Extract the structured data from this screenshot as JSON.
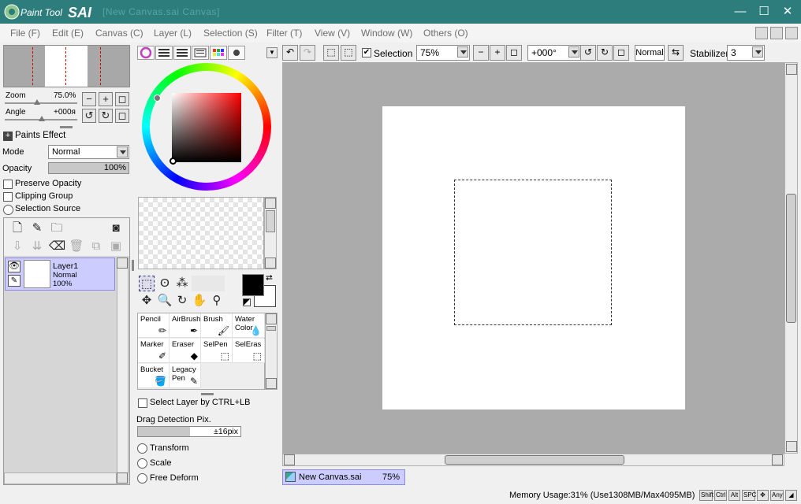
{
  "app": {
    "logo_text": "Paint Tool SAI",
    "title": "[New Canvas.sai  Canvas]"
  },
  "window_controls": {
    "minimize": "—",
    "maximize": "☐",
    "close": "✕"
  },
  "menu": {
    "items": [
      "File (F)",
      "Edit (E)",
      "Canvas (C)",
      "Layer (L)",
      "Selection (S)",
      "Filter (T)",
      "View (V)",
      "Window (W)",
      "Others (O)"
    ]
  },
  "navigator": {
    "zoom_label": "Zoom",
    "zoom_value": "75.0%",
    "angle_label": "Angle",
    "angle_value": "+000я"
  },
  "paints": {
    "header": "Paints Effect",
    "mode_label": "Mode",
    "mode_value": "Normal",
    "opacity_label": "Opacity",
    "opacity_value": "100%",
    "opacity_fraction": 1.0,
    "preserve_opacity": "Preserve Opacity",
    "clipping_group": "Clipping Group",
    "selection_source": "Selection Source"
  },
  "layer": {
    "name": "Layer1",
    "mode": "Normal",
    "opacity": "100%"
  },
  "tools": {
    "brushes": [
      {
        "label": "Pencil",
        "icon": "pencil-icon"
      },
      {
        "label": "AirBrush",
        "icon": "airbrush-icon"
      },
      {
        "label": "Brush",
        "icon": "brush-icon"
      },
      {
        "label": "Water Color",
        "icon": "watercolor-icon"
      },
      {
        "label": "Marker",
        "icon": "marker-icon"
      },
      {
        "label": "Eraser",
        "icon": "eraser-icon"
      },
      {
        "label": "SelPen",
        "icon": "selpen-icon"
      },
      {
        "label": "SelEras",
        "icon": "seleras-icon"
      },
      {
        "label": "Bucket",
        "icon": "bucket-icon"
      },
      {
        "label": "Legacy Pen",
        "icon": "legacy-pen-icon"
      }
    ],
    "select_layer_label": "Select Layer by CTRL+LB",
    "drag_detection_label": "Drag Detection Pix.",
    "drag_detection_value": "±16pix",
    "transform": "Transform",
    "scale": "Scale",
    "free_deform": "Free Deform"
  },
  "toolbar": {
    "selection_label": "Selection",
    "zoom_value": "75%",
    "angle_value": "+000°",
    "blend_mode": "Normal",
    "stabilizer_label": "Stabilizer",
    "stabilizer_value": "3"
  },
  "canvas_tab": {
    "name": "New Canvas.sai",
    "zoom": "75%"
  },
  "status": {
    "memory": "Memory Usage:31% (Use1308MB/Max4095MB)",
    "keys": [
      "Shift",
      "Ctrl",
      "Alt",
      "SPC",
      "✥",
      "Any",
      "◢"
    ]
  },
  "colors": {
    "title_bg": "#2d7d7d",
    "foreground": "#000000",
    "background": "#ffffff",
    "layer_selected": "#ccccff",
    "canvas_bg": "#ababab"
  }
}
